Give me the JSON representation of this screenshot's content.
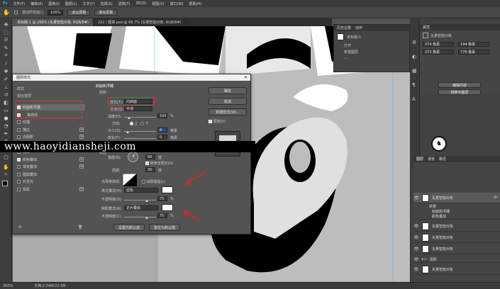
{
  "menubar": [
    "Ps",
    "文件(F)",
    "编辑(E)",
    "图像(I)",
    "图层(L)",
    "文字(Y)",
    "选择(S)",
    "滤镜(T)",
    "3D(D)",
    "视图(V)",
    "窗口(W)",
    "帮助(H)"
  ],
  "options": {
    "scroll_all": "滚动所有窗口",
    "zoom": "100%",
    "fit_screen": "适合屏幕",
    "fill_screen": "填充屏幕"
  },
  "tabs": [
    "未标题-1 @ 200% (矢量智能对象, RGB/8#)",
    "222 / 图章.psd @ 66.7% (矢量智能对象, RGB/8#)"
  ],
  "status": {
    "zoom": "200%",
    "doc": "文档:2.54M/22.5M"
  },
  "history": {
    "tab1": "历史记录",
    "tab2": "动作",
    "snapshot": "未标题-1",
    "items": [
      "打开",
      "新建图层",
      "...."
    ]
  },
  "properties": {
    "title": "属性",
    "sub": "矢量智能对象",
    "w": "374 像素",
    "h": "194 像素",
    "x": "375 像素",
    "y": "776 像素",
    "btn1": "编辑内容",
    "btn2": "转换为图层"
  },
  "layers_panel": {
    "tabs": [
      "图层",
      "通道",
      "路径"
    ],
    "items": [
      {
        "name": "矢量智能对象",
        "sub": ""
      },
      {
        "name": "效果",
        "sub": ""
      },
      {
        "name": "斜面和浮雕",
        "sub": ""
      },
      {
        "name": "颜色叠加",
        "sub": ""
      },
      {
        "name": "矢量智能对象",
        "sub": ""
      },
      {
        "name": "矢量智能对象",
        "sub": ""
      },
      {
        "name": "矢量智能对象",
        "sub": ""
      },
      {
        "name": "阴影",
        "sub": ""
      },
      {
        "name": "矢量智能对象",
        "sub": ""
      }
    ]
  },
  "dialog": {
    "title": "图层样式",
    "styles_header": "样式",
    "blend_header": "混合选项",
    "style_items": [
      {
        "label": "斜面和浮雕",
        "checked": true,
        "plus": false
      },
      {
        "label": "等高线",
        "checked": true,
        "plus": false
      },
      {
        "label": "纹理",
        "checked": false,
        "plus": false
      },
      {
        "label": "描边",
        "checked": false,
        "plus": true
      },
      {
        "label": "内阴影",
        "checked": false,
        "plus": true
      },
      {
        "label": "内发光",
        "checked": false,
        "plus": false
      },
      {
        "label": "光泽",
        "checked": false,
        "plus": false
      },
      {
        "label": "颜色叠加",
        "checked": true,
        "plus": true
      },
      {
        "label": "渐变叠加",
        "checked": false,
        "plus": true
      },
      {
        "label": "图案叠加",
        "checked": false,
        "plus": false
      },
      {
        "label": "外发光",
        "checked": false,
        "plus": false
      },
      {
        "label": "投影",
        "checked": false,
        "plus": true
      }
    ],
    "section_title": "斜面和浮雕",
    "struct_title": "结构",
    "style_label": "样式(T):",
    "style_value": "内斜面",
    "method_label": "方法(Q):",
    "method_value": "平滑",
    "depth_label": "深度(D):",
    "depth_value": "100",
    "pct": "%",
    "dir_label": "方向:",
    "dir_up": "上",
    "dir_down": "下",
    "size_label": "大小(Z):",
    "size_value": "8",
    "px": "像素",
    "soften_label": "软化(F):",
    "soften_value": "0",
    "shading_title": "阴影",
    "angle_label": "角度(N):",
    "angle_value": "60",
    "deg": "度",
    "global_light": "使用全局光(G)",
    "altitude_label": "高度:",
    "altitude_value": "30",
    "gloss_label": "光泽等高线:",
    "antialias": "消除锯齿(L)",
    "highlight_label": "高光模式(H):",
    "highlight_value": "滤色",
    "hl_opacity_label": "不透明度(O):",
    "hl_opacity_value": "75",
    "shadow_label": "阴影模式(A):",
    "shadow_value": "正片叠底",
    "sh_opacity_label": "不透明度(C):",
    "sh_opacity_value": "75",
    "set_default": "设置为默认值",
    "reset_default": "复位为默认值",
    "ok": "确定",
    "cancel": "取消",
    "new_style": "新建样式(W)...",
    "preview": "预览(V)",
    "fx": "fx"
  },
  "watermark": "www.haoyidiansheji.com",
  "colors": {
    "accent": "#d43a3a",
    "canvas_bg": "#bdbdbd"
  }
}
